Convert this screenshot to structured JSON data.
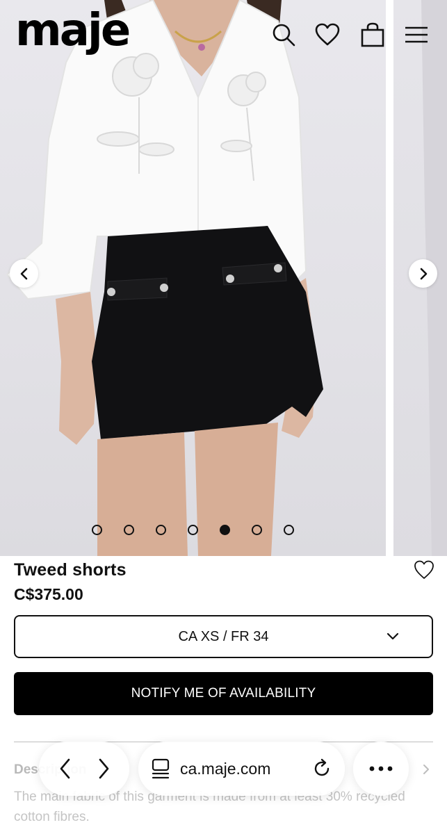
{
  "header": {
    "logo": "maje",
    "icons": [
      "search-icon",
      "heart-icon",
      "bag-icon",
      "menu-icon"
    ]
  },
  "carousel": {
    "slide_count": 7,
    "active_index": 4
  },
  "product": {
    "title": "Tweed shorts",
    "price": "C$375.00",
    "size_selected": "CA XS / FR 34",
    "cta_label": "NOTIFY ME OF AVAILABILITY"
  },
  "description": {
    "heading": "Description",
    "text": "The main fabric of this garment is made from at least 30% recycled cotton fibres."
  },
  "browser": {
    "url": "ca.maje.com"
  },
  "colors": {
    "primary": "#000000",
    "background": "#ffffff",
    "muted_text": "#c4c4c4"
  }
}
